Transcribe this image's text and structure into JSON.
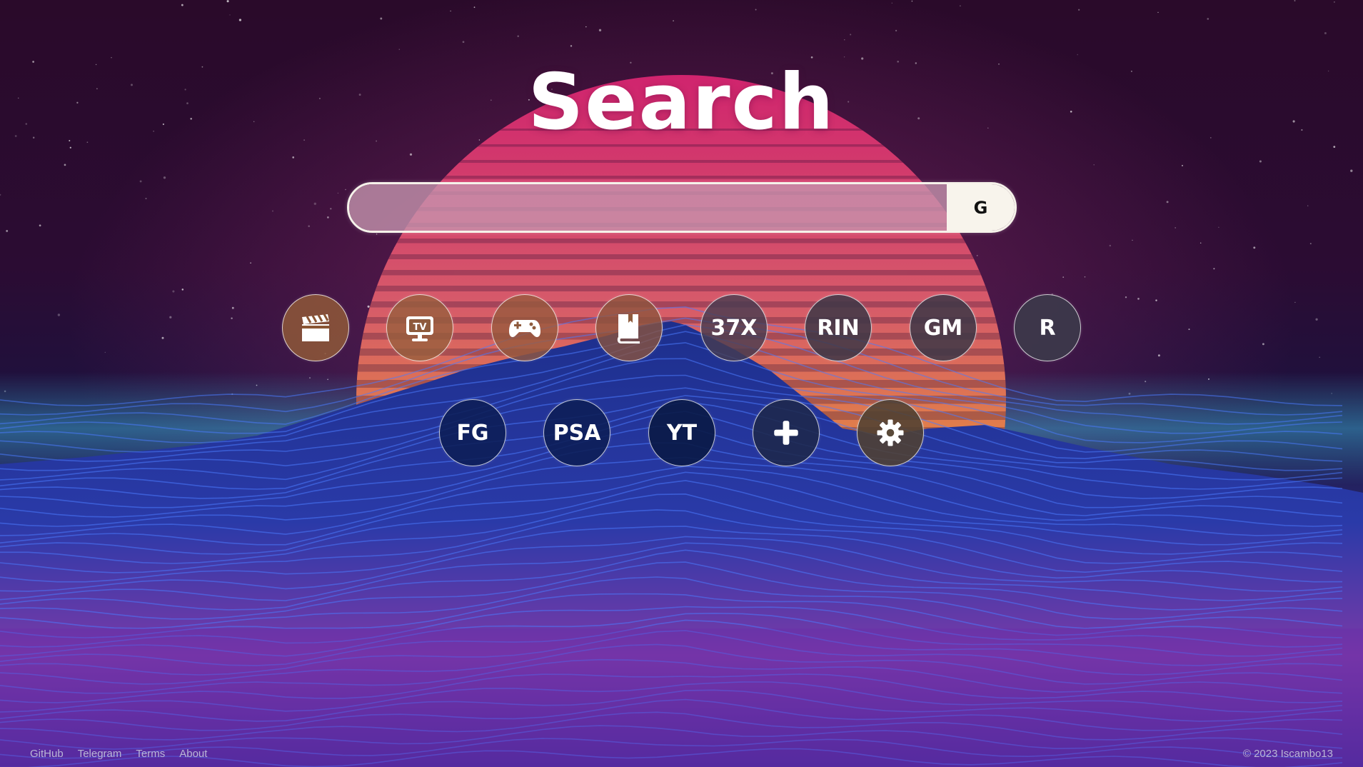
{
  "title": "Search",
  "search": {
    "value": "",
    "placeholder": "",
    "engine_label": "G",
    "engine_icon": "google-g-icon"
  },
  "shortcuts": {
    "row1": [
      {
        "label": "",
        "icon": "clapperboard-icon"
      },
      {
        "label": "",
        "icon": "tv-icon"
      },
      {
        "label": "",
        "icon": "gamepad-icon"
      },
      {
        "label": "",
        "icon": "book-icon"
      },
      {
        "label": "37X",
        "icon": ""
      },
      {
        "label": "RIN",
        "icon": ""
      },
      {
        "label": "GM",
        "icon": ""
      },
      {
        "label": "R",
        "icon": ""
      }
    ],
    "row2": [
      {
        "label": "FG",
        "icon": ""
      },
      {
        "label": "PSA",
        "icon": ""
      },
      {
        "label": "YT",
        "icon": ""
      },
      {
        "label": "",
        "icon": "plus-icon"
      },
      {
        "label": "",
        "icon": "gear-icon"
      }
    ]
  },
  "footer": {
    "links": [
      "GitHub",
      "Telegram",
      "Terms",
      "About"
    ],
    "copyright": "© 2023 Iscambo13"
  },
  "colors": {
    "sky_top": "#2a0a2e",
    "sun_top": "#d8307a",
    "sun_bottom": "#f0a020",
    "mountain": "#1a2f8a",
    "mountain_lines": "#3d6dff",
    "search_border": "#f6f2ea",
    "footer_text": "#b9b6d6"
  }
}
